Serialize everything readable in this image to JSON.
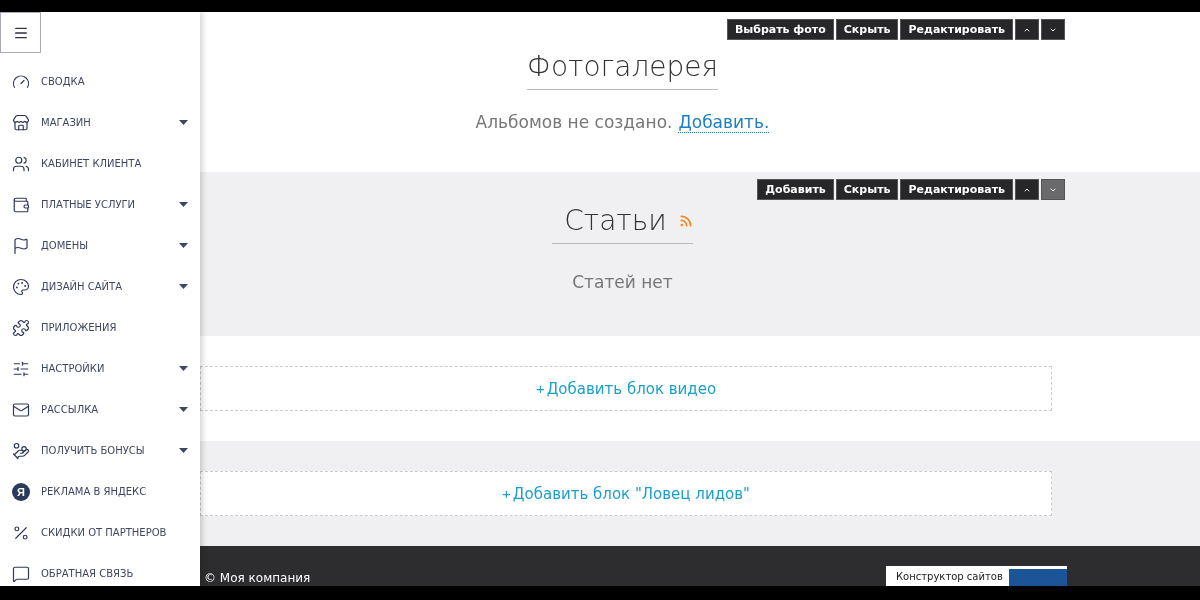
{
  "sidebar": {
    "items": [
      {
        "label": "СВОДКА",
        "has_submenu": false
      },
      {
        "label": "МАГАЗИН",
        "has_submenu": true
      },
      {
        "label": "КАБИНЕТ КЛИЕНТА",
        "has_submenu": false
      },
      {
        "label": "ПЛАТНЫЕ УСЛУГИ",
        "has_submenu": true
      },
      {
        "label": "ДОМЕНЫ",
        "has_submenu": true
      },
      {
        "label": "ДИЗАЙН САЙТА",
        "has_submenu": true
      },
      {
        "label": "ПРИЛОЖЕНИЯ",
        "has_submenu": false
      },
      {
        "label": "НАСТРОЙКИ",
        "has_submenu": true
      },
      {
        "label": "РАССЫЛКА",
        "has_submenu": true
      },
      {
        "label": "ПОЛУЧИТЬ БОНУСЫ",
        "has_submenu": true
      },
      {
        "label": "РЕКЛАМА В ЯНДЕКС",
        "icon_text": "Я",
        "has_submenu": false
      },
      {
        "label": "СКИДКИ ОТ ПАРТНЕРОВ",
        "has_submenu": false
      },
      {
        "label": "ОБРАТНАЯ СВЯЗЬ",
        "has_submenu": false
      }
    ]
  },
  "gallery": {
    "toolbar": [
      {
        "kind": "text",
        "label": "Выбрать фото",
        "disabled": false
      },
      {
        "kind": "text",
        "label": "Скрыть",
        "disabled": false
      },
      {
        "kind": "text",
        "label": "Редактировать",
        "disabled": false
      },
      {
        "kind": "up",
        "disabled": false
      },
      {
        "kind": "down",
        "disabled": false
      }
    ],
    "title": "Фотогалерея",
    "empty_text": "Альбомов не создано.",
    "add_link": "Добавить."
  },
  "articles": {
    "toolbar": [
      {
        "kind": "text",
        "label": "Добавить",
        "disabled": false
      },
      {
        "kind": "text",
        "label": "Скрыть",
        "disabled": false
      },
      {
        "kind": "text",
        "label": "Редактировать",
        "disabled": false
      },
      {
        "kind": "up",
        "disabled": false
      },
      {
        "kind": "down",
        "disabled": true
      }
    ],
    "title": "Статьи",
    "empty_text": "Статей нет"
  },
  "add_blocks": [
    {
      "plus": "+",
      "label": "Добавить блок видео"
    },
    {
      "plus": "+",
      "label": "Добавить блок \"Ловец лидов\""
    }
  ],
  "footer": {
    "copyright": "© Моя компания",
    "badge_text": "Конструктор сайтов"
  }
}
